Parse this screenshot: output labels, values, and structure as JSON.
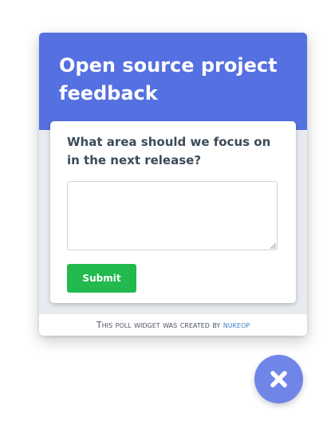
{
  "widget": {
    "title": "Open source project feedback",
    "question": "What area should we focus on in the next release?",
    "answer": {
      "value": "",
      "placeholder": ""
    },
    "submit_label": "Submit",
    "footer": {
      "text": "This poll widget was created by",
      "link_label": "nukeop"
    }
  },
  "close_button": {
    "icon": "close-icon"
  },
  "colors": {
    "header": "#5470e1",
    "submit": "#22b94f",
    "close_button": "#6f85e8",
    "footer_link": "#3f7fc4"
  }
}
